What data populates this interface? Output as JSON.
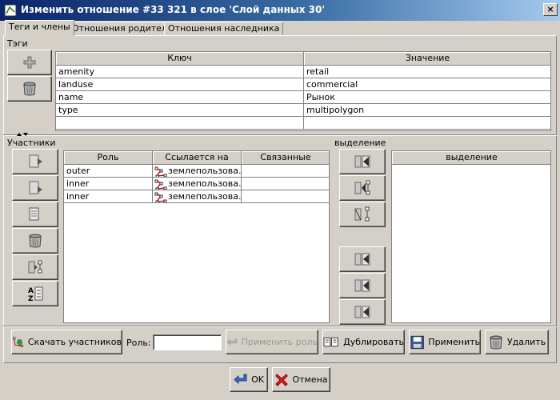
{
  "window": {
    "title": "Изменить отношение #33 321 в слое 'Слой данных 30'",
    "close_label": "×"
  },
  "tabs": [
    {
      "label": "Теги и члены",
      "active": true
    },
    {
      "label": "Отношения родителя",
      "active": false
    },
    {
      "label": "Отношения наследника",
      "active": false
    }
  ],
  "tags": {
    "group_label": "Тэги",
    "columns": [
      "Ключ",
      "Значение"
    ],
    "rows": [
      {
        "key": "amenity",
        "value": "retail"
      },
      {
        "key": "landuse",
        "value": "commercial"
      },
      {
        "key": "name",
        "value": "Рынок"
      },
      {
        "key": "type",
        "value": "multipolygon"
      },
      {
        "key": "",
        "value": ""
      }
    ],
    "buttons": [
      {
        "name": "add-tag-button",
        "icon": "plus-icon"
      },
      {
        "name": "delete-tag-button",
        "icon": "trash-icon"
      }
    ]
  },
  "members": {
    "group_label": "Участники",
    "columns": [
      "Роль",
      "Ссылается на",
      "Связанные"
    ],
    "rows": [
      {
        "role": "outer",
        "ref": "землепользова...",
        "linked": ""
      },
      {
        "role": "inner",
        "ref": "землепользова...",
        "linked": ""
      },
      {
        "role": "inner",
        "ref": "землепользова...",
        "linked": ""
      }
    ],
    "buttons": [
      {
        "name": "move-member-up-button",
        "icon": "move-up-icon"
      },
      {
        "name": "move-member-down-button",
        "icon": "move-down-icon"
      },
      {
        "name": "edit-member-button",
        "icon": "edit-member-icon"
      },
      {
        "name": "remove-member-button",
        "icon": "trash-icon"
      },
      {
        "name": "select-member-button",
        "icon": "select-member-icon"
      },
      {
        "name": "sort-members-button",
        "icon": "sort-az-icon"
      }
    ]
  },
  "selection": {
    "group_label": "выделение",
    "column": "выделение",
    "buttons": [
      {
        "name": "add-selected-to-start-button",
        "icon": "add-selection-start-icon"
      },
      {
        "name": "add-selected-after-button",
        "icon": "add-selection-after-icon"
      },
      {
        "name": "remove-selected-button",
        "icon": "remove-selection-icon"
      },
      {
        "name": "add-selected-before-button",
        "icon": "add-selection-before-icon"
      },
      {
        "name": "add-selected-at-end-button",
        "icon": "add-selection-end-icon"
      },
      {
        "name": "add-selected-end2-button",
        "icon": "add-selection-end-icon"
      }
    ]
  },
  "bottom_bar": {
    "download_label": "Скачать участников",
    "role_label": "Роль:",
    "role_value": "",
    "apply_role_label": "Применить роль",
    "duplicate_label": "Дублировать",
    "apply_label": "Применить",
    "delete_label": "Удалить"
  },
  "dialog_buttons": {
    "ok_label": "OK",
    "cancel_label": "Отмена"
  },
  "colors": {
    "title_bar": "#0a246a",
    "window_bg": "#d4d0c8",
    "link_icon": "#c00000"
  }
}
